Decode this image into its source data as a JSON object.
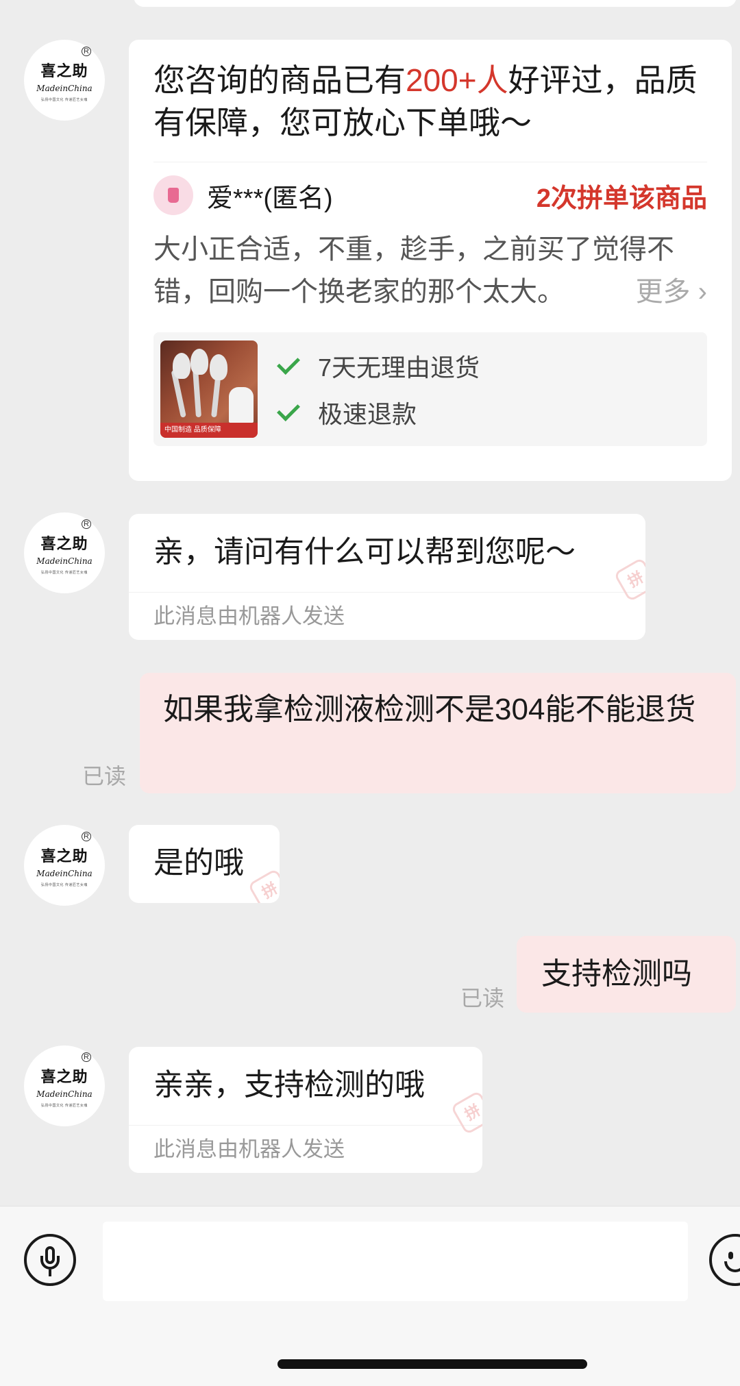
{
  "shop": {
    "avatar_name": "喜之助",
    "avatar_en": "MadeinChina",
    "avatar_tagline": "弘扬中国文化 传递匠艺女魂",
    "avatar_reg": "R"
  },
  "review_card": {
    "title_before": "您咨询的商品已有",
    "title_highlight": "200+人",
    "title_after": "好评过，品质有保障，您可放心下单哦～",
    "reviewer_name": "爱***(匿名)",
    "repeat_buy": "2次拼单该商品",
    "review_text": "大小正合适，不重，趁手，之前买了觉得不错，回购一个换老家的那个太大。",
    "more_label": "更多",
    "product_banner": "中国制造 品质保障",
    "guarantees": [
      {
        "label": "7天无理由退货"
      },
      {
        "label": "极速退款"
      }
    ]
  },
  "messages": [
    {
      "from": "shop",
      "text": "亲，请问有什么可以帮到您呢～",
      "note": "此消息由机器人发送"
    },
    {
      "from": "me",
      "text": "如果我拿检测液检测不是304能不能退货",
      "status": "已读"
    },
    {
      "from": "shop",
      "text": "是的哦"
    },
    {
      "from": "me",
      "text": "支持检测吗",
      "status": "已读"
    },
    {
      "from": "shop",
      "text": "亲亲，支持检测的哦",
      "note": "此消息由机器人发送"
    }
  ],
  "watermark_char": "拼",
  "input": {
    "value": "",
    "placeholder": ""
  },
  "colors": {
    "accent_red": "#d4372c",
    "my_bubble": "#fbe7e7",
    "background": "#ededed",
    "check_green": "#3aa64a"
  }
}
